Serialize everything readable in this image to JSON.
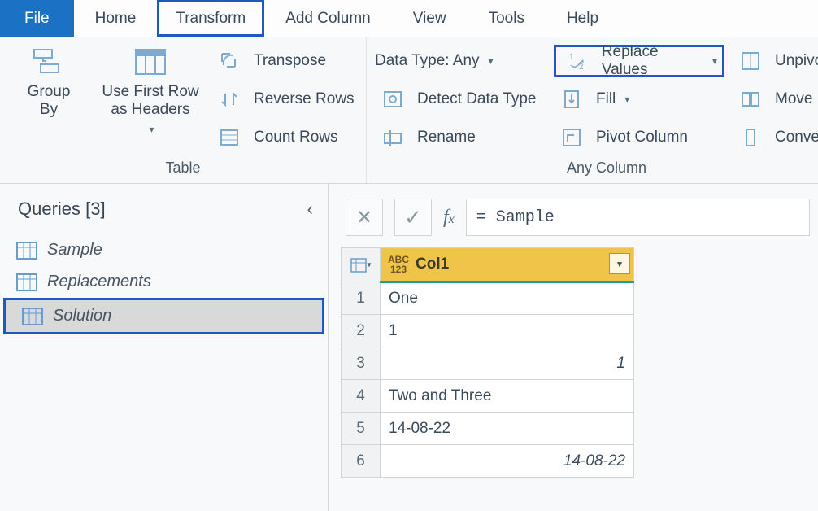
{
  "tabs": {
    "file": "File",
    "home": "Home",
    "transform": "Transform",
    "addcolumn": "Add Column",
    "view": "View",
    "tools": "Tools",
    "help": "Help"
  },
  "ribbon": {
    "groupTable": "Table",
    "groupAnyColumn": "Any Column",
    "groupBy": "Group\nBy",
    "useFirstRow": "Use First Row\nas Headers",
    "transpose": "Transpose",
    "reverseRows": "Reverse Rows",
    "countRows": "Count Rows",
    "dataType": "Data Type: Any",
    "detectDataType": "Detect Data Type",
    "rename": "Rename",
    "replaceValues": "Replace Values",
    "fill": "Fill",
    "pivotColumn": "Pivot Column",
    "unpivot": "Unpivot",
    "move": "Move",
    "convert": "Convert t"
  },
  "sidebar": {
    "title": "Queries [3]",
    "items": [
      {
        "label": "Sample"
      },
      {
        "label": "Replacements"
      },
      {
        "label": "Solution"
      }
    ]
  },
  "formula": {
    "text": "= Sample"
  },
  "grid": {
    "column": "Col1",
    "rows": [
      {
        "value": "One",
        "align": "left"
      },
      {
        "value": "1",
        "align": "left"
      },
      {
        "value": "1",
        "align": "right"
      },
      {
        "value": "Two and Three",
        "align": "left"
      },
      {
        "value": "14-08-22",
        "align": "left"
      },
      {
        "value": "14-08-22",
        "align": "right"
      }
    ]
  }
}
